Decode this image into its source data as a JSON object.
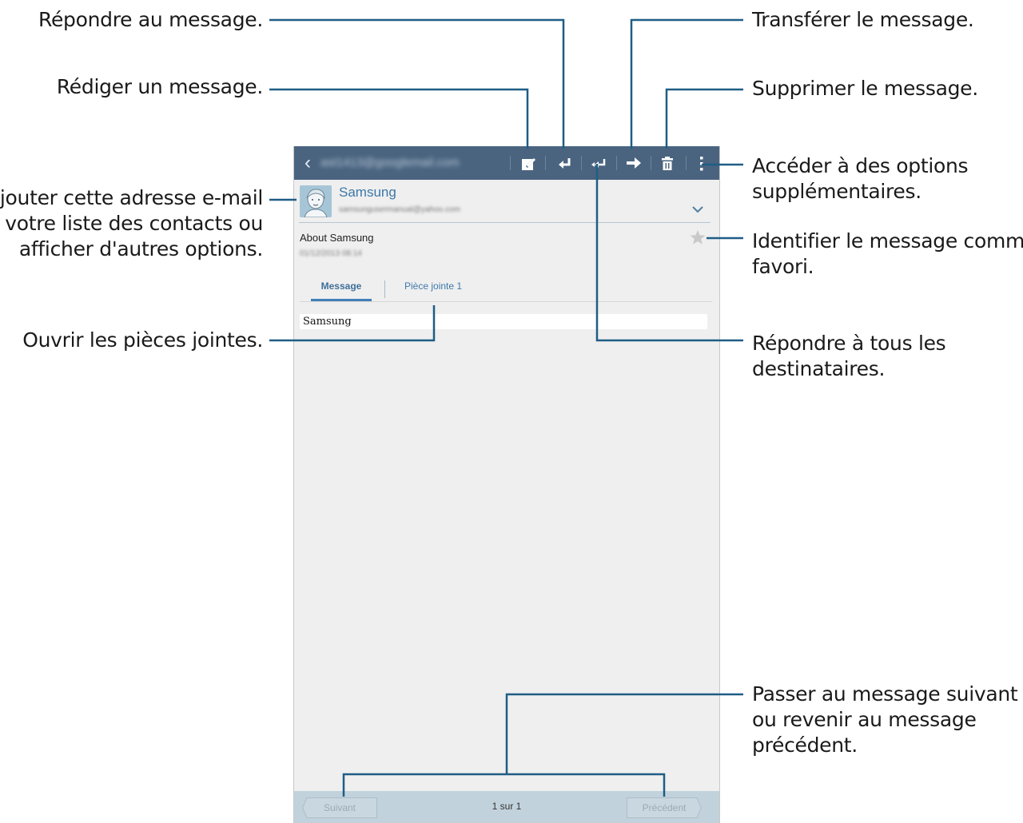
{
  "callouts": {
    "reply": "Répondre au message.",
    "compose": "Rédiger un message.",
    "contact": [
      "Ajouter cette adresse e-mail",
      "à votre liste des contacts ou",
      "afficher d'autres options."
    ],
    "attachments": "Ouvrir les pièces jointes.",
    "forward": "Transférer le message.",
    "delete": "Supprimer le message.",
    "more": [
      "Accéder à des options",
      "supplémentaires."
    ],
    "favorite": [
      "Identifier le message comme",
      "favori."
    ],
    "reply_all": [
      "Répondre à tous les",
      "destinataires."
    ],
    "navigate": [
      "Passer au message suivant",
      "ou revenir au message",
      "précédent."
    ]
  },
  "app": {
    "account": "ast1413@googlemail.com",
    "actions": [
      "back-icon",
      "compose-icon",
      "reply-icon",
      "reply-all-icon",
      "forward-icon",
      "delete-icon",
      "more-options-icon"
    ]
  },
  "message": {
    "sender_name": "Samsung",
    "sender_email": "samsungusermanual@yahoo.com",
    "subject": "About Samsung",
    "date": "01/12/2013 08:14",
    "body": "Samsung"
  },
  "tabs": {
    "message": "Message",
    "attachment": "Pièce jointe 1"
  },
  "footer": {
    "next": "Suivant",
    "previous": "Précédent",
    "page_indicator": "1 sur 1"
  },
  "colors": {
    "action_bar": "#4a6480",
    "accent": "#3d77a8",
    "leader_line": "#1f5d86",
    "bottom_bar": "#c2d2dc"
  }
}
